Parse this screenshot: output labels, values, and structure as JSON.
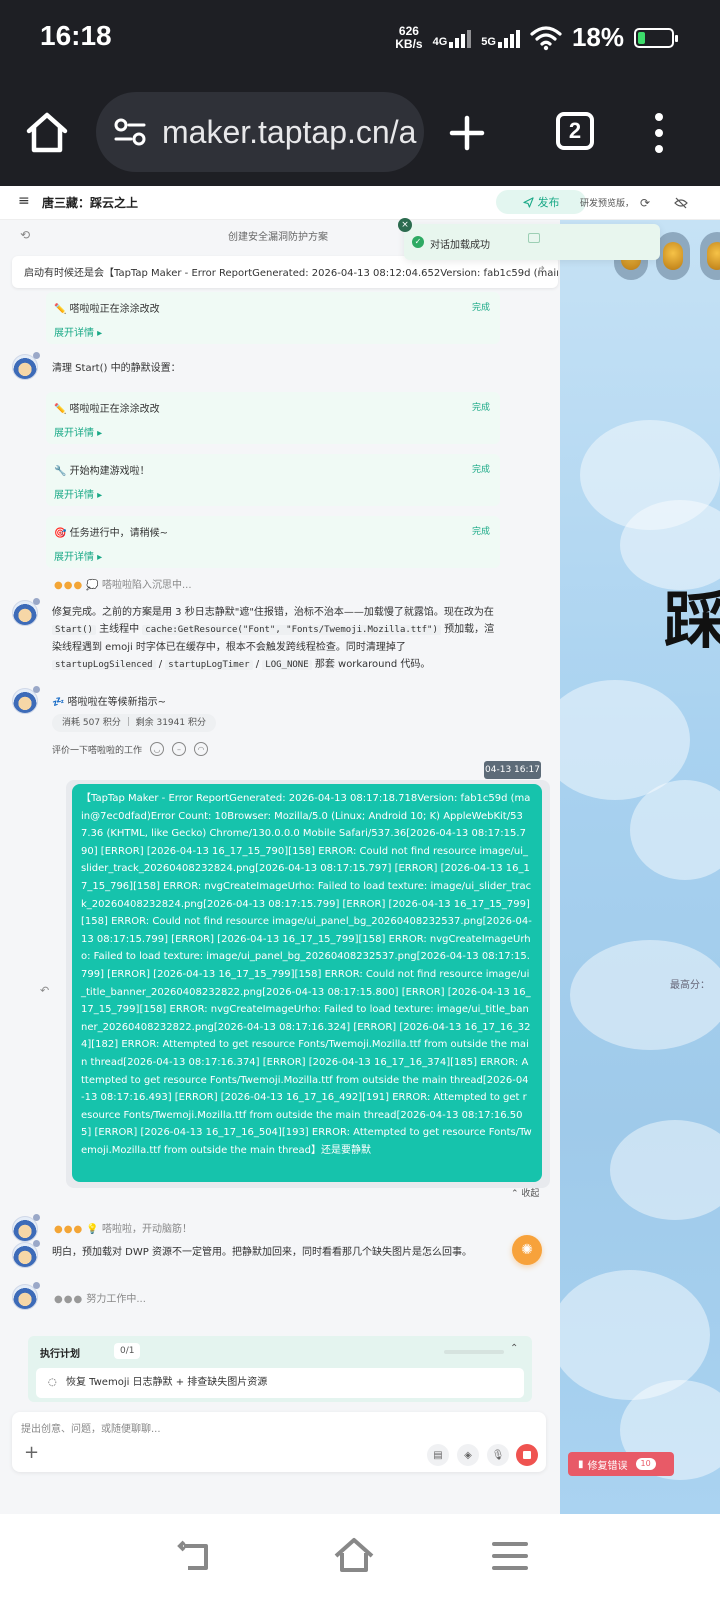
{
  "status_bar": {
    "time": "16:18",
    "speed_value": "626",
    "speed_unit": "KB/s",
    "net1": "4G",
    "net2": "5G",
    "battery": "18%"
  },
  "browser": {
    "url": "maker.taptap.cn/a",
    "tab_count": "2"
  },
  "app": {
    "menu_icon": "≡",
    "project_title": "唐三藏：踩云之上",
    "publish_label": "发布",
    "preview_mode": "研发预览版，不会上传",
    "subtitle": "创建安全漏洞防护方案",
    "error_bar": "启动有时候还是会【TapTap Maker - Error ReportGenerated: 2026-04-13 08:12:04.652Version: fab1c59d (main@7ec0dfad)Error Count"
  },
  "toast": {
    "text": "对话加载成功"
  },
  "messages": {
    "tool1": {
      "label": "✏️ 嗒啦啦正在涂涂改改",
      "status": "完成",
      "expand": "展开详情 ▸"
    },
    "cleanup_text": "清理 Start() 中的静默设置：",
    "tool2": {
      "label": "✏️ 嗒啦啦正在涂涂改改",
      "status": "完成",
      "expand": "展开详情 ▸"
    },
    "tool3": {
      "label": "🔧 开始构建游戏啦！",
      "status": "完成",
      "expand": "展开详情 ▸"
    },
    "tool4": {
      "label": "🎯 任务进行中，请稍候~",
      "status": "完成",
      "expand": "展开详情 ▸"
    },
    "thinking1_dots": "●●●",
    "thinking1": "💭 嗒啦啦陷入沉思中...",
    "fix_para": {
      "p1": "修复完成。之前的方案是用 3 秒日志静默\"遮\"住报错，治标不治本——加载慢了就露馅。现在改为在 ",
      "c1": "Start()",
      "p2": " 主线程中 ",
      "c2": "cache:GetResource(\"Font\", \"Fonts/Twemoji.Mozilla.ttf\")",
      "p3": " 预加载，渲染线程遇到 emoji 时字体已在缓存中，根本不会触发跨线程检查。同时清理掉了 ",
      "c3": "startupLogSilenced",
      "p4": " / ",
      "c4": "startupLogTimer",
      "p5": " / ",
      "c5": "LOG_NONE",
      "p6": " 那套 workaround 代码。"
    },
    "waiting": "💤 嗒啦啦在等候新指示~",
    "credits": "消耗 507 积分 ｜ 剩余 31941 积分",
    "rate_label": "评价一下嗒啦啦的工作",
    "timestamp": "04-13 16:17",
    "user_message": "【TapTap Maker - Error ReportGenerated: 2026-04-13 08:17:18.718Version: fab1c59d (main@7ec0dfad)Error Count: 10Browser: Mozilla/5.0 (Linux; Android 10; K) AppleWebKit/537.36 (KHTML, like Gecko) Chrome/130.0.0.0 Mobile Safari/537.36[2026-04-13 08:17:15.790] [ERROR] [2026-04-13 16_17_15_790][158] ERROR: Could not find resource image/ui_slider_track_20260408232824.png[2026-04-13 08:17:15.797] [ERROR] [2026-04-13 16_17_15_796][158] ERROR: nvgCreateImageUrho: Failed to load texture: image/ui_slider_track_20260408232824.png[2026-04-13 08:17:15.799] [ERROR] [2026-04-13 16_17_15_799][158] ERROR: Could not find resource image/ui_panel_bg_20260408232537.png[2026-04-13 08:17:15.799] [ERROR] [2026-04-13 16_17_15_799][158] ERROR: nvgCreateImageUrho: Failed to load texture: image/ui_panel_bg_20260408232537.png[2026-04-13 08:17:15.799] [ERROR] [2026-04-13 16_17_15_799][158] ERROR: Could not find resource image/ui_title_banner_20260408232822.png[2026-04-13 08:17:15.800] [ERROR] [2026-04-13 16_17_15_799][158] ERROR: nvgCreateImageUrho: Failed to load texture: image/ui_title_banner_20260408232822.png[2026-04-13 08:17:16.324] [ERROR] [2026-04-13 16_17_16_324][182] ERROR: Attempted to get resource Fonts/Twemoji.Mozilla.ttf from outside the main thread[2026-04-13 08:17:16.374] [ERROR] [2026-04-13 16_17_16_374][185] ERROR: Attempted to get resource Fonts/Twemoji.Mozilla.ttf from outside the main thread[2026-04-13 08:17:16.493] [ERROR] [2026-04-13 16_17_16_492][191] ERROR: Attempted to get resource Fonts/Twemoji.Mozilla.ttf from outside the main thread[2026-04-13 08:17:16.505] [ERROR] [2026-04-13 16_17_16_504][193] ERROR: Attempted to get resource Fonts/Twemoji.Mozilla.ttf from outside the main thread】还是要静默",
    "collapse": "⌃ 收起",
    "thinking2_dots": "●●●",
    "thinking2": "💡 嗒啦啦，开动脑筋！",
    "reply": "明白，预加载对 DWP 资源不一定管用。把静默加回来，同时看看那几个缺失图片是怎么回事。",
    "working_dots": "●●●",
    "working": "努力工作中..."
  },
  "plan": {
    "title": "执行计划",
    "count": "0/1",
    "task": "恢复 Twemoji 日志静默 + 排查缺失图片资源"
  },
  "input": {
    "placeholder": "提出创意、问题，或随便聊聊..."
  },
  "game": {
    "best_score": "最高分：",
    "fix_label": "修复错误",
    "fix_count": "10",
    "calligraphy": "踩"
  },
  "colors": {
    "accent": "#16c3ac",
    "done_green": "#1aa987",
    "fix_red": "#e85a67",
    "fab_orange": "#f7a23b"
  }
}
